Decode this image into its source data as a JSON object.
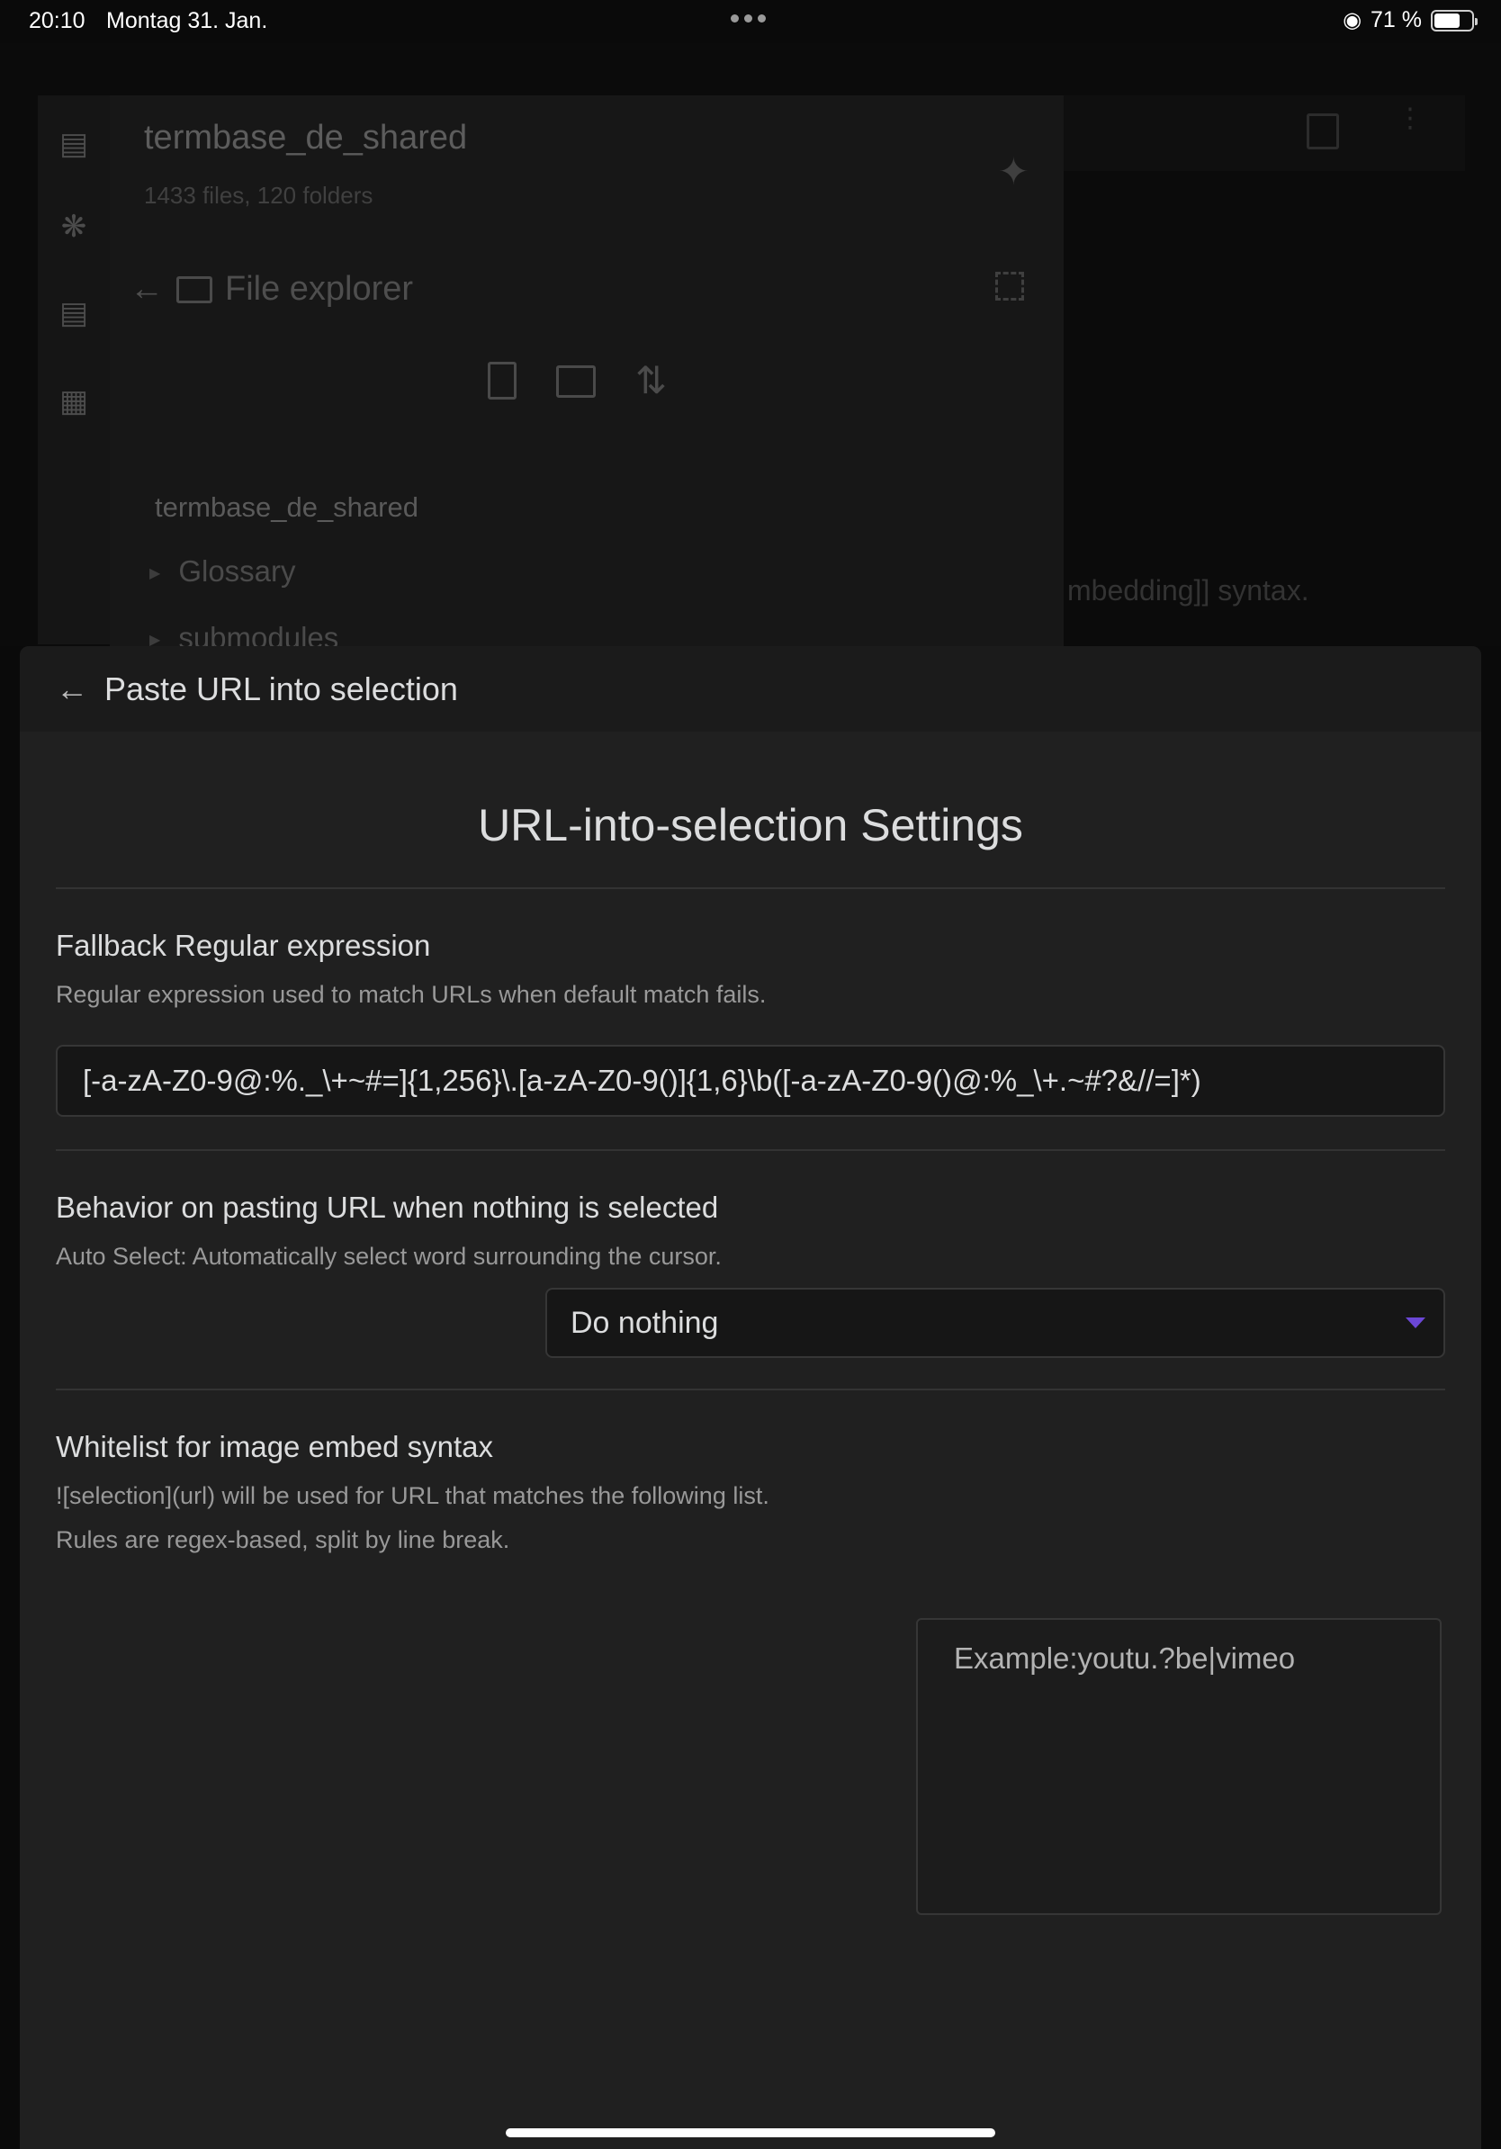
{
  "status_bar": {
    "time": "20:10",
    "date": "Montag 31. Jan.",
    "battery": "71 %",
    "battery_level": 0.71
  },
  "background": {
    "vault_title": "termbase_de_shared",
    "vault_stats": "1433 files, 120 folders",
    "panel_title": "File explorer",
    "tree_root": "termbase_de_shared",
    "tree_items": [
      "Glossary",
      "submodules"
    ],
    "snippet": "mbedding]] syntax."
  },
  "modal": {
    "back_label": "Paste URL into selection",
    "heading": "URL-into-selection Settings",
    "fallback_regex": {
      "name": "Fallback Regular expression",
      "desc": "Regular expression used to match URLs when default match fails.",
      "value": "[-a-zA-Z0-9@:%._\\+~#=]{1,256}\\.[a-zA-Z0-9()]{1,6}\\b([-a-zA-Z0-9()@:%_\\+.~#?&//=]*)"
    },
    "nothing_selected": {
      "name": "Behavior on pasting URL when nothing is selected",
      "desc": "Auto Select: Automatically select word surrounding the cursor.",
      "selected": "Do nothing"
    },
    "whitelist": {
      "name": "Whitelist for image embed syntax",
      "desc1": "![selection](url) will be used for URL that matches the following list.",
      "desc2": "Rules are regex-based, split by line break.",
      "placeholder": "Example:youtu.?be|vimeo"
    }
  }
}
